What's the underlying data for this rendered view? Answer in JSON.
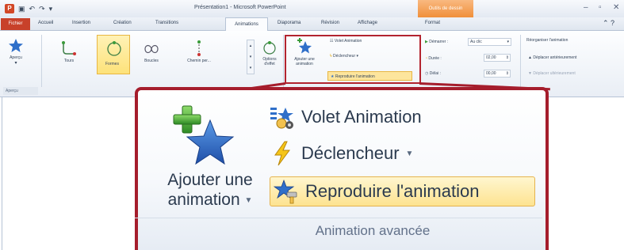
{
  "window": {
    "title": "Présentation1 - Microsoft PowerPoint",
    "context_tab": "Outils de dessin",
    "controls": [
      "–",
      "▫",
      "✕"
    ]
  },
  "tabs": [
    {
      "label": "Fichier"
    },
    {
      "label": "Accueil"
    },
    {
      "label": "Insertion"
    },
    {
      "label": "Création"
    },
    {
      "label": "Transitions"
    },
    {
      "label": "Animations"
    },
    {
      "label": "Diaporama"
    },
    {
      "label": "Révision"
    },
    {
      "label": "Affichage"
    },
    {
      "label": "Format"
    }
  ],
  "ribbon": {
    "apercu_button": "Aperçu",
    "apercu_group": "Aperçu",
    "gallery": [
      "Tours",
      "Formes",
      "Boucles",
      "Chemin per..."
    ],
    "options": "Options\nd'effet",
    "add_animation": "Ajouter une\nanimation",
    "volet": "Volet Animation",
    "declencheur": "Déclencheur",
    "reproduire": "Reproduire l'animation",
    "demarrer_label": "Démarrer :",
    "demarrer_value": "Au clic",
    "duree_label": "Durée :",
    "duree_value": "02,00",
    "delai_label": "Délai :",
    "delai_value": "00,00",
    "reorg_title": "Réorganiser l'animation",
    "move_earlier": "Déplacer antérieurement",
    "move_later": "Déplacer ultérieurement"
  },
  "zoom": {
    "add_animation_line1": "Ajouter une",
    "add_animation_line2": "animation",
    "volet": "Volet Animation",
    "declencheur": "Déclencheur",
    "reproduire": "Reproduire l'animation",
    "group_label": "Animation avancée"
  },
  "colors": {
    "highlight_border": "#a51d2c",
    "selected_fill": "#fde390",
    "fichier_tab": "#c8412a"
  }
}
